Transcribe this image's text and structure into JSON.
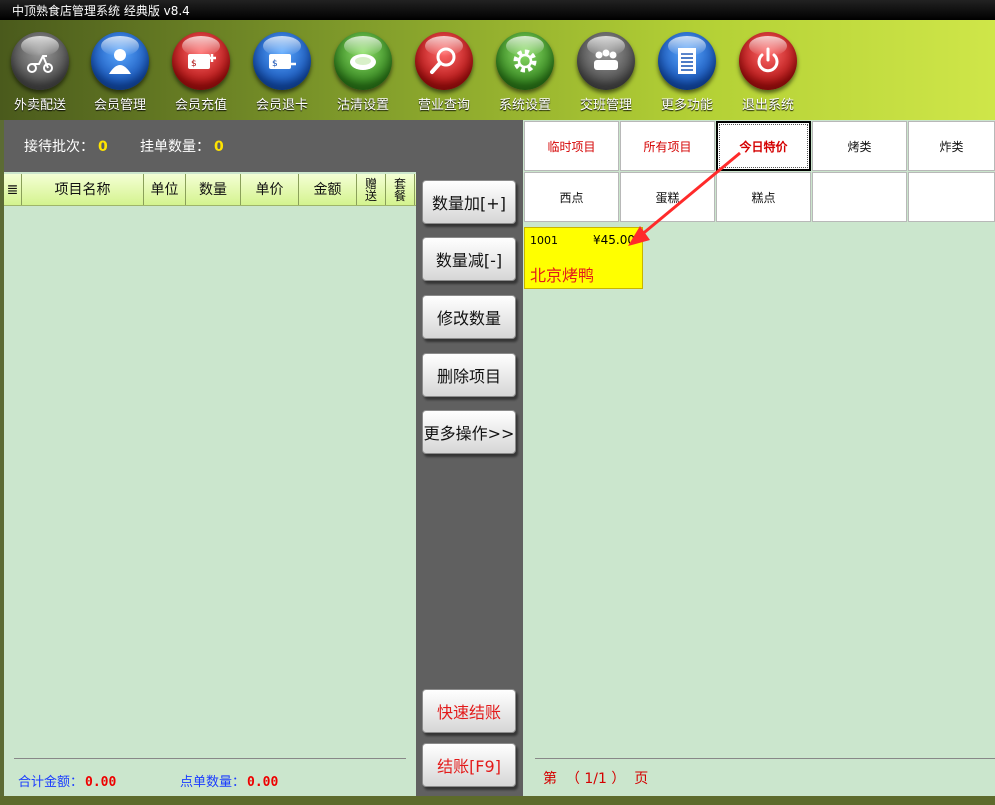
{
  "window": {
    "title": "中顶熟食店管理系统 经典版 v8.4"
  },
  "toolbar": {
    "items": [
      {
        "label": "外卖配送",
        "icon": "scooter-icon",
        "color": "#5d5d5d"
      },
      {
        "label": "会员管理",
        "icon": "user-icon",
        "color": "#1e6fd0"
      },
      {
        "label": "会员充值",
        "icon": "card-add-icon",
        "color": "#d01c1c"
      },
      {
        "label": "会员退卡",
        "icon": "card-remove-icon",
        "color": "#1e6fd0"
      },
      {
        "label": "沽清设置",
        "icon": "plate-icon",
        "color": "#3f9a2a"
      },
      {
        "label": "营业查询",
        "icon": "search-icon",
        "color": "#d01c1c"
      },
      {
        "label": "系统设置",
        "icon": "gear-icon",
        "color": "#3f9a2a"
      },
      {
        "label": "交班管理",
        "icon": "team-icon",
        "color": "#5d5d5d"
      },
      {
        "label": "更多功能",
        "icon": "list-icon",
        "color": "#1e6fd0"
      },
      {
        "label": "退出系统",
        "icon": "power-icon",
        "color": "#d01c1c"
      }
    ]
  },
  "order": {
    "waiting_label": "接待批次：",
    "waiting_value": "0",
    "pending_label": "挂单数量：",
    "pending_value": "0",
    "columns": [
      "≣",
      "项目名称",
      "单位",
      "数量",
      "单价",
      "金额",
      "赠送",
      "套餐"
    ],
    "total_label": "合计金额：",
    "total_value": "0.00",
    "count_label": "点单数量：",
    "count_value": "0.00"
  },
  "actions": {
    "qty_add": "数量加[+]",
    "qty_sub": "数量减[-]",
    "qty_edit": "修改数量",
    "delete_item": "删除项目",
    "more_ops": "更多操作>>",
    "quick_checkout": "快速结账",
    "checkout": "结账[F9]"
  },
  "categories": {
    "row1": [
      "临时项目",
      "所有项目",
      "今日特价",
      "烤类",
      "炸类"
    ],
    "row2": [
      "西点",
      "蛋糕",
      "糕点",
      "",
      ""
    ],
    "selected": "今日特价",
    "accent": "#d40000"
  },
  "items": [
    {
      "code": "1001",
      "price": "¥45.00",
      "name": "北京烤鸭"
    }
  ],
  "pagination": {
    "text": "第  （ 1/1 ）  页"
  }
}
